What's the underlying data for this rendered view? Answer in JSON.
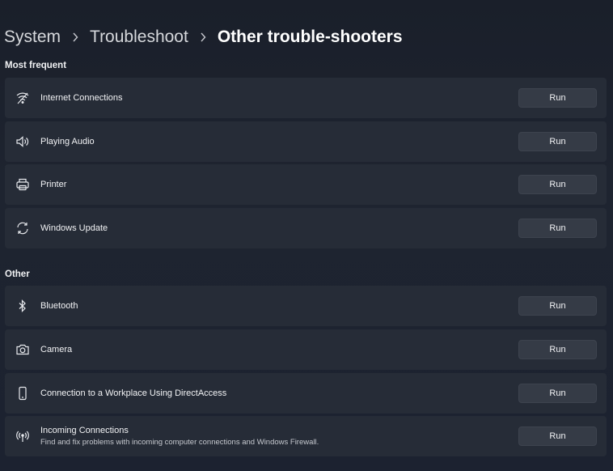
{
  "breadcrumb": {
    "items": [
      "System",
      "Troubleshoot",
      "Other trouble-shooters"
    ]
  },
  "sections": {
    "most_frequent": {
      "title": "Most frequent",
      "items": [
        {
          "label": "Internet Connections",
          "icon": "wifi-icon",
          "button": "Run"
        },
        {
          "label": "Playing Audio",
          "icon": "speaker-icon",
          "button": "Run"
        },
        {
          "label": "Printer",
          "icon": "printer-icon",
          "button": "Run"
        },
        {
          "label": "Windows Update",
          "icon": "refresh-icon",
          "button": "Run"
        }
      ]
    },
    "other": {
      "title": "Other",
      "items": [
        {
          "label": "Bluetooth",
          "icon": "bluetooth-icon",
          "button": "Run"
        },
        {
          "label": "Camera",
          "icon": "camera-icon",
          "button": "Run"
        },
        {
          "label": "Connection to a Workplace Using DirectAccess",
          "icon": "phone-device-icon",
          "button": "Run"
        },
        {
          "label": "Incoming Connections",
          "description": "Find and fix problems with incoming computer connections and Windows Firewall.",
          "icon": "antenna-icon",
          "button": "Run"
        }
      ]
    }
  },
  "colors": {
    "background": "#1b2029",
    "card": "#262c37",
    "button": "#353b46",
    "text": "#ffffff"
  }
}
